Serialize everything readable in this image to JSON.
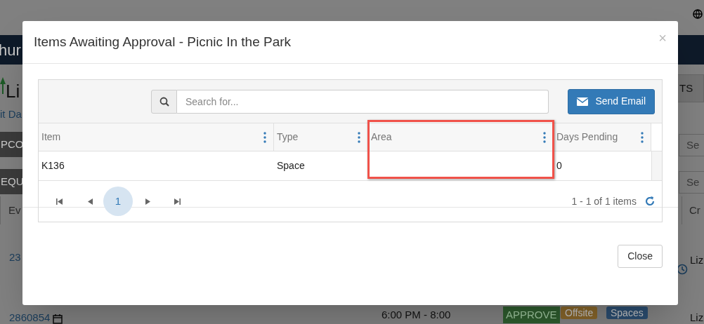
{
  "background": {
    "brand": "hur",
    "logo_text": "Li",
    "link": "it Da",
    "tabs": [
      "PCO",
      "EQU"
    ],
    "right_button": "TS",
    "search_fields": [
      "Se",
      "Se"
    ],
    "table_headers": [
      "Ev",
      "Cr"
    ],
    "rows": [
      {
        "id": "23",
        "creator": "Liz"
      },
      {
        "id": "2860854",
        "time": "6:00 PM - 8:00",
        "action": "APPROVE",
        "creator": "Liz",
        "tags": [
          {
            "label": "Offsite",
            "color": "#87652a"
          },
          {
            "label": "Spaces",
            "color": "#2b4d70"
          }
        ]
      }
    ]
  },
  "modal": {
    "title": "Items Awaiting Approval - Picnic In the Park",
    "close_glyph": "×",
    "search": {
      "placeholder": "Search for..."
    },
    "send_email_button": "Send Email",
    "columns": [
      {
        "label": "Item",
        "highlighted": false
      },
      {
        "label": "Type",
        "highlighted": false
      },
      {
        "label": "Area",
        "highlighted": true
      },
      {
        "label": "Days Pending",
        "highlighted": false
      }
    ],
    "rows": [
      {
        "cells": [
          "K136",
          "Space",
          null,
          "0"
        ]
      }
    ],
    "pager": {
      "pages": [
        {
          "label": "1",
          "selected": true
        }
      ],
      "summary": "1 - 1 of 1 items"
    },
    "footer_button": "Close"
  }
}
